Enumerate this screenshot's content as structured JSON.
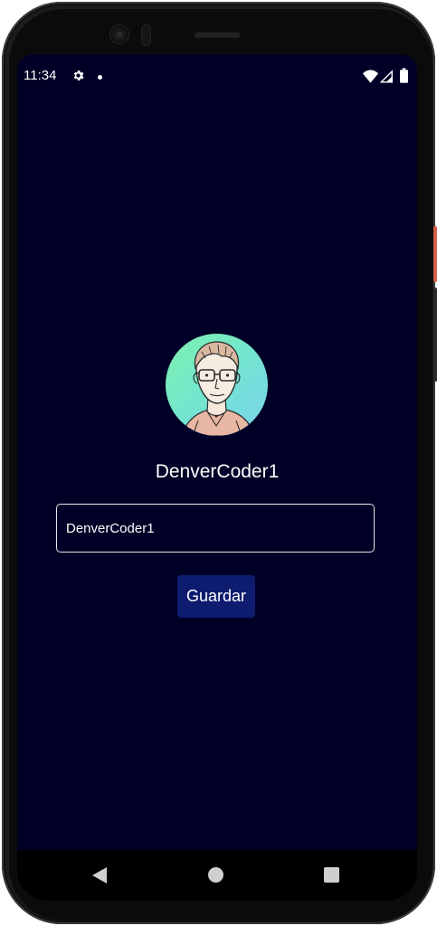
{
  "status_bar": {
    "time": "11:34",
    "icons": [
      "settings-gear-icon",
      "notification-dot-icon",
      "wifi-icon",
      "cell-signal-icon",
      "battery-icon"
    ]
  },
  "profile": {
    "avatar_icon": "avatar-portrait-icon",
    "username": "DenverCoder1"
  },
  "form": {
    "name_input_value": "DenverCoder1",
    "save_label": "Guardar"
  },
  "navigation": {
    "icons": [
      "back-icon",
      "home-icon",
      "recents-icon"
    ]
  },
  "colors": {
    "background": "#000027",
    "button": "#0d1c6e",
    "text": "#ffffff",
    "avatar_gradient_start": "#7ef2b0",
    "avatar_gradient_end": "#79d3ef"
  }
}
